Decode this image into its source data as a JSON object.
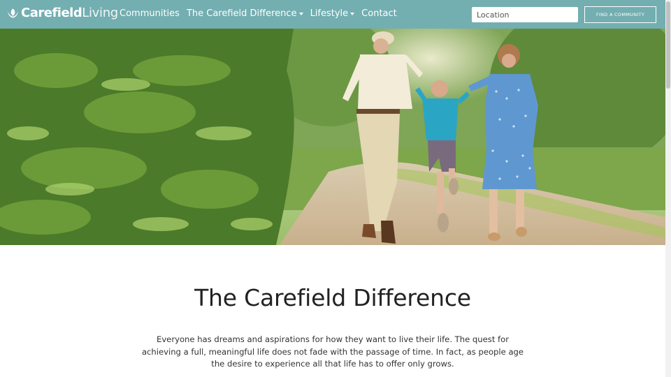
{
  "header": {
    "brand_strong": "Carefield",
    "brand_light": "Living",
    "nav": [
      {
        "label": "Communities",
        "dropdown": false
      },
      {
        "label": "The Carefield Difference",
        "dropdown": true
      },
      {
        "label": "Lifestyle",
        "dropdown": true
      },
      {
        "label": "Contact",
        "dropdown": false
      }
    ],
    "location_placeholder": "Location",
    "find_button": "FIND A COMMUNITY"
  },
  "hero": {
    "image": "grandparents-with-child-on-park-path"
  },
  "main": {
    "title": "The Carefield Difference",
    "paragraph": "Everyone has dreams and aspirations for how they want to live their life. The quest for achieving a full, meaningful life does not fade with the passage of time. In fact, as people age the desire to experience all that life has to offer only grows."
  },
  "colors": {
    "nav_bg": "#73aeb1",
    "text": "#333333"
  }
}
